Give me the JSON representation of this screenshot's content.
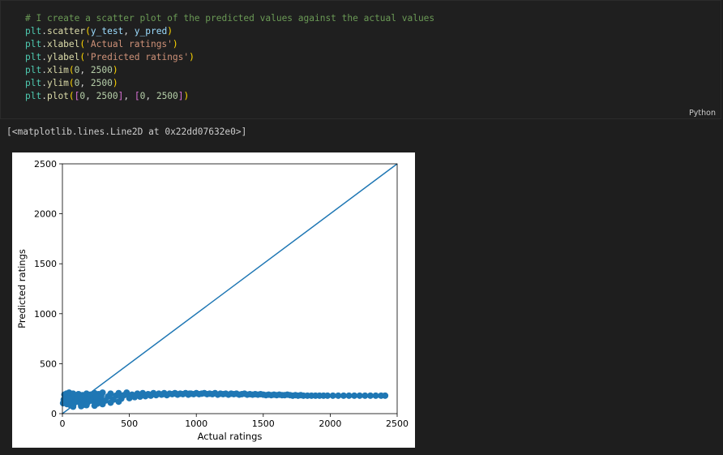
{
  "cell": {
    "language_label": "Python",
    "code_lines": [
      [
        {
          "t": "# I create a scatter plot of the predicted values against the actual values",
          "c": "c-comment"
        }
      ],
      [
        {
          "t": "plt",
          "c": "c-var"
        },
        {
          "t": ".",
          "c": "c-plain"
        },
        {
          "t": "scatter",
          "c": "c-fn"
        },
        {
          "t": "(",
          "c": "c-paren1"
        },
        {
          "t": "y_test",
          "c": "c-arg"
        },
        {
          "t": ", ",
          "c": "c-plain"
        },
        {
          "t": "y_pred",
          "c": "c-arg"
        },
        {
          "t": ")",
          "c": "c-paren1"
        }
      ],
      [
        {
          "t": "plt",
          "c": "c-var"
        },
        {
          "t": ".",
          "c": "c-plain"
        },
        {
          "t": "xlabel",
          "c": "c-fn"
        },
        {
          "t": "(",
          "c": "c-paren1"
        },
        {
          "t": "'Actual ratings'",
          "c": "c-str"
        },
        {
          "t": ")",
          "c": "c-paren1"
        }
      ],
      [
        {
          "t": "plt",
          "c": "c-var"
        },
        {
          "t": ".",
          "c": "c-plain"
        },
        {
          "t": "ylabel",
          "c": "c-fn"
        },
        {
          "t": "(",
          "c": "c-paren1"
        },
        {
          "t": "'Predicted ratings'",
          "c": "c-str"
        },
        {
          "t": ")",
          "c": "c-paren1"
        }
      ],
      [
        {
          "t": "plt",
          "c": "c-var"
        },
        {
          "t": ".",
          "c": "c-plain"
        },
        {
          "t": "xlim",
          "c": "c-fn"
        },
        {
          "t": "(",
          "c": "c-paren1"
        },
        {
          "t": "0",
          "c": "c-num"
        },
        {
          "t": ", ",
          "c": "c-plain"
        },
        {
          "t": "2500",
          "c": "c-num"
        },
        {
          "t": ")",
          "c": "c-paren1"
        }
      ],
      [
        {
          "t": "plt",
          "c": "c-var"
        },
        {
          "t": ".",
          "c": "c-plain"
        },
        {
          "t": "ylim",
          "c": "c-fn"
        },
        {
          "t": "(",
          "c": "c-paren1"
        },
        {
          "t": "0",
          "c": "c-num"
        },
        {
          "t": ", ",
          "c": "c-plain"
        },
        {
          "t": "2500",
          "c": "c-num"
        },
        {
          "t": ")",
          "c": "c-paren1"
        }
      ],
      [
        {
          "t": "plt",
          "c": "c-var"
        },
        {
          "t": ".",
          "c": "c-plain"
        },
        {
          "t": "plot",
          "c": "c-fn"
        },
        {
          "t": "(",
          "c": "c-paren1"
        },
        {
          "t": "[",
          "c": "c-paren2"
        },
        {
          "t": "0",
          "c": "c-num"
        },
        {
          "t": ", ",
          "c": "c-plain"
        },
        {
          "t": "2500",
          "c": "c-num"
        },
        {
          "t": "]",
          "c": "c-paren2"
        },
        {
          "t": ", ",
          "c": "c-plain"
        },
        {
          "t": "[",
          "c": "c-paren2"
        },
        {
          "t": "0",
          "c": "c-num"
        },
        {
          "t": ", ",
          "c": "c-plain"
        },
        {
          "t": "2500",
          "c": "c-num"
        },
        {
          "t": "]",
          "c": "c-paren2"
        },
        {
          "t": ")",
          "c": "c-paren1"
        }
      ]
    ]
  },
  "output": {
    "text": "[<matplotlib.lines.Line2D at 0x22dd07632e0>]"
  },
  "chart_data": {
    "type": "scatter",
    "xlabel": "Actual ratings",
    "ylabel": "Predicted ratings",
    "xlim": [
      0,
      2500
    ],
    "ylim": [
      0,
      2500
    ],
    "xticks": [
      0,
      500,
      1000,
      1500,
      2000,
      2500
    ],
    "yticks": [
      0,
      500,
      1000,
      1500,
      2000,
      2500
    ],
    "grid": false,
    "scatter_color": "#1f77b4",
    "line_color": "#1f77b4",
    "reference_line": {
      "x": [
        0,
        2500
      ],
      "y": [
        0,
        2500
      ]
    },
    "points": [
      [
        5,
        105
      ],
      [
        10,
        140
      ],
      [
        15,
        190
      ],
      [
        20,
        120
      ],
      [
        25,
        160
      ],
      [
        30,
        200
      ],
      [
        35,
        95
      ],
      [
        40,
        130
      ],
      [
        45,
        175
      ],
      [
        50,
        210
      ],
      [
        55,
        110
      ],
      [
        60,
        150
      ],
      [
        65,
        185
      ],
      [
        70,
        125
      ],
      [
        75,
        165
      ],
      [
        80,
        200
      ],
      [
        85,
        100
      ],
      [
        90,
        140
      ],
      [
        95,
        180
      ],
      [
        100,
        120
      ],
      [
        110,
        155
      ],
      [
        120,
        195
      ],
      [
        130,
        110
      ],
      [
        140,
        145
      ],
      [
        150,
        185
      ],
      [
        160,
        125
      ],
      [
        170,
        160
      ],
      [
        180,
        200
      ],
      [
        190,
        115
      ],
      [
        200,
        150
      ],
      [
        210,
        190
      ],
      [
        220,
        130
      ],
      [
        230,
        170
      ],
      [
        240,
        205
      ],
      [
        250,
        120
      ],
      [
        260,
        160
      ],
      [
        270,
        195
      ],
      [
        280,
        135
      ],
      [
        290,
        175
      ],
      [
        300,
        210
      ],
      [
        320,
        130
      ],
      [
        340,
        170
      ],
      [
        360,
        200
      ],
      [
        380,
        140
      ],
      [
        400,
        180
      ],
      [
        420,
        205
      ],
      [
        440,
        150
      ],
      [
        460,
        185
      ],
      [
        480,
        210
      ],
      [
        500,
        155
      ],
      [
        520,
        190
      ],
      [
        540,
        165
      ],
      [
        560,
        200
      ],
      [
        580,
        170
      ],
      [
        600,
        205
      ],
      [
        620,
        175
      ],
      [
        640,
        195
      ],
      [
        660,
        180
      ],
      [
        680,
        205
      ],
      [
        700,
        185
      ],
      [
        720,
        200
      ],
      [
        740,
        190
      ],
      [
        760,
        205
      ],
      [
        780,
        185
      ],
      [
        800,
        200
      ],
      [
        820,
        195
      ],
      [
        840,
        205
      ],
      [
        860,
        190
      ],
      [
        880,
        200
      ],
      [
        900,
        195
      ],
      [
        920,
        205
      ],
      [
        940,
        190
      ],
      [
        960,
        200
      ],
      [
        980,
        195
      ],
      [
        1000,
        205
      ],
      [
        1020,
        195
      ],
      [
        1040,
        200
      ],
      [
        1060,
        205
      ],
      [
        1080,
        195
      ],
      [
        1100,
        200
      ],
      [
        1120,
        195
      ],
      [
        1140,
        205
      ],
      [
        1160,
        190
      ],
      [
        1180,
        200
      ],
      [
        1200,
        195
      ],
      [
        1220,
        200
      ],
      [
        1240,
        190
      ],
      [
        1260,
        200
      ],
      [
        1280,
        195
      ],
      [
        1300,
        200
      ],
      [
        1320,
        190
      ],
      [
        1340,
        195
      ],
      [
        1360,
        200
      ],
      [
        1380,
        190
      ],
      [
        1400,
        195
      ],
      [
        1420,
        190
      ],
      [
        1440,
        195
      ],
      [
        1460,
        190
      ],
      [
        1480,
        195
      ],
      [
        1500,
        190
      ],
      [
        1520,
        185
      ],
      [
        1540,
        190
      ],
      [
        1560,
        185
      ],
      [
        1580,
        190
      ],
      [
        1600,
        185
      ],
      [
        1620,
        190
      ],
      [
        1640,
        185
      ],
      [
        1660,
        185
      ],
      [
        1680,
        190
      ],
      [
        1700,
        185
      ],
      [
        1720,
        180
      ],
      [
        1740,
        185
      ],
      [
        1760,
        180
      ],
      [
        1780,
        185
      ],
      [
        1800,
        180
      ],
      [
        1830,
        180
      ],
      [
        1860,
        180
      ],
      [
        1890,
        180
      ],
      [
        1920,
        180
      ],
      [
        1950,
        180
      ],
      [
        1980,
        180
      ],
      [
        2020,
        180
      ],
      [
        2060,
        180
      ],
      [
        2100,
        180
      ],
      [
        2140,
        180
      ],
      [
        2180,
        180
      ],
      [
        2220,
        180
      ],
      [
        2260,
        180
      ],
      [
        2300,
        180
      ],
      [
        2340,
        180
      ],
      [
        2380,
        180
      ],
      [
        2410,
        180
      ],
      [
        50,
        150
      ],
      [
        150,
        160
      ],
      [
        250,
        170
      ],
      [
        350,
        175
      ],
      [
        450,
        180
      ],
      [
        550,
        185
      ],
      [
        650,
        190
      ],
      [
        750,
        195
      ],
      [
        850,
        198
      ],
      [
        950,
        200
      ],
      [
        60,
        85
      ],
      [
        160,
        90
      ],
      [
        260,
        100
      ],
      [
        360,
        110
      ],
      [
        140,
        75
      ],
      [
        240,
        80
      ],
      [
        80,
        70
      ],
      [
        180,
        85
      ],
      [
        300,
        95
      ],
      [
        420,
        120
      ]
    ]
  }
}
